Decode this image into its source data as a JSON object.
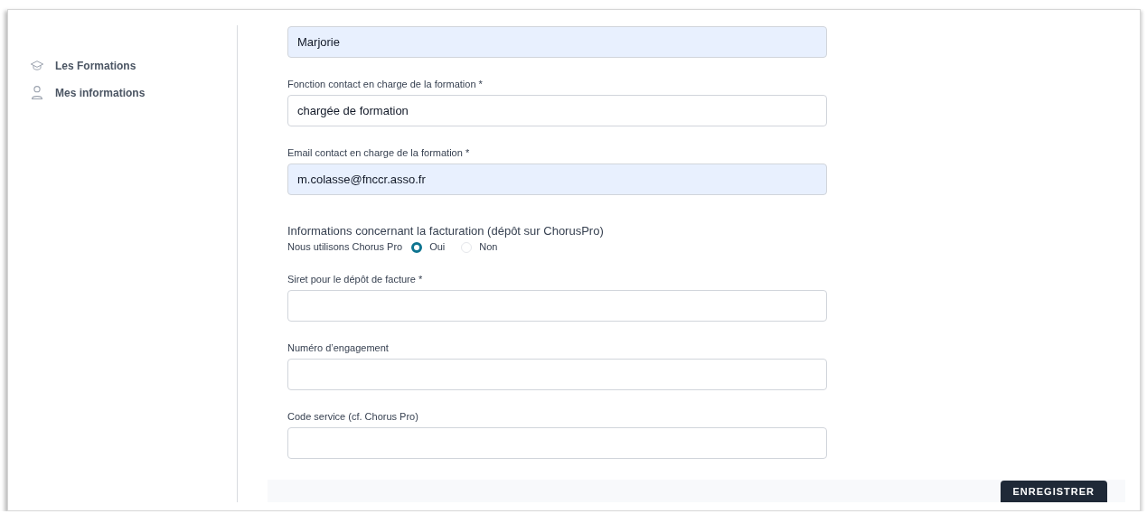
{
  "sidebar": {
    "items": [
      {
        "label": "Les Formations"
      },
      {
        "label": "Mes informations"
      }
    ]
  },
  "fields_top": [
    {
      "value": "Marjorie",
      "autofilled": true
    },
    {
      "label": "Fonction contact en charge de la formation *",
      "value": "chargée de formation",
      "autofilled": false
    },
    {
      "label": "Email contact en charge de la formation *",
      "value": "m.colasse@fnccr.asso.fr",
      "autofilled": true
    }
  ],
  "billing": {
    "heading": "Informations concernant la facturation (dépôt sur ChorusPro)",
    "question": "Nous utilisons Chorus Pro",
    "options": [
      {
        "label": "Oui",
        "selected": true
      },
      {
        "label": "Non",
        "selected": false
      }
    ]
  },
  "fields_bottom": [
    {
      "label": "Siret pour le dépôt de facture *",
      "autofilled": false
    },
    {
      "label": "Numéro d’engagement",
      "autofilled": false
    },
    {
      "label": "Code service (cf. Chorus Pro)",
      "autofilled": false
    }
  ],
  "save_button": "ENREGISTRER"
}
